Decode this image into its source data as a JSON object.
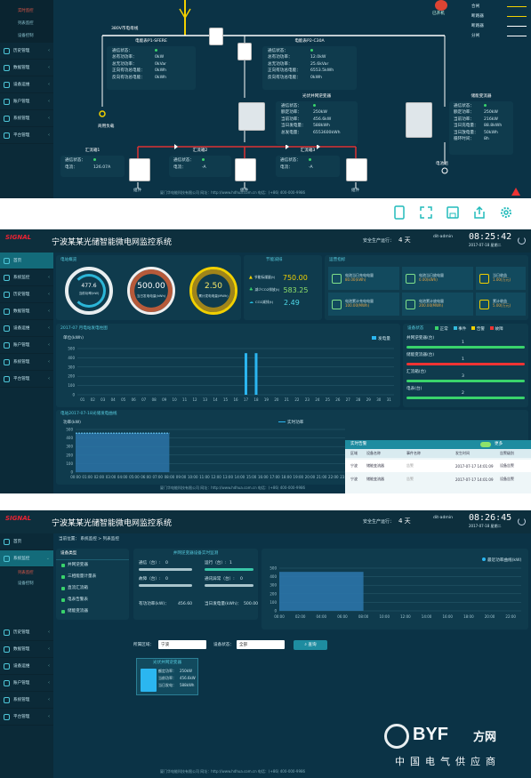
{
  "sec1": {
    "sidebar": {
      "sub": [
        "实时监控",
        "列表监控",
        "设备控制"
      ],
      "items": [
        "历史管理",
        "数据管理",
        "设备运维",
        "账户管理",
        "系统管理",
        "平台管理"
      ]
    },
    "legend": [
      "合闸",
      "断路器",
      "断路器",
      "分闸"
    ],
    "alarm_label": "已开机",
    "bus_label": "380V市电母线",
    "load_label": "商用负载",
    "grid_label": "电池组",
    "meter1": {
      "title": "电能表P1-SFERE",
      "rows": [
        [
          "通信状态：",
          ""
        ],
        [
          "总有功功率：",
          "0kW"
        ],
        [
          "总无功功率：",
          "0kVar"
        ],
        [
          "正向有功总电能：",
          "0kWh"
        ],
        [
          "反向有功总电能：",
          "0kWh"
        ]
      ]
    },
    "meter2": {
      "title": "电能表P2-C30A",
      "rows": [
        [
          "通信状态：",
          ""
        ],
        [
          "总有功功率：",
          "12.0kW"
        ],
        [
          "总无功功率：",
          "25.6kVar"
        ],
        [
          "正向有功总电能：",
          "6553.5kWh"
        ],
        [
          "反向有功总电能：",
          "0kWh"
        ]
      ]
    },
    "pv": {
      "title": "光伏并网逆变器",
      "rows": [
        [
          "通信状态：",
          ""
        ],
        [
          "额定功率：",
          "250kW"
        ],
        [
          "当前功率：",
          "456.6kW"
        ],
        [
          "当日发电量：",
          "588kWh"
        ],
        [
          "总发电量：",
          "6553600kWh"
        ]
      ]
    },
    "storage": {
      "title": "储能变流器",
      "rows": [
        [
          "通信状态：",
          ""
        ],
        [
          "额定功率：",
          "250kW"
        ],
        [
          "当前功率：",
          "216kW"
        ],
        [
          "当日充电量：",
          "88.8kWh"
        ],
        [
          "当日放电量：",
          "50kWh"
        ],
        [
          "循环时间：",
          "8h"
        ]
      ]
    },
    "boxes": [
      {
        "title": "汇流箱1",
        "rows": [
          [
            "通信状态：",
            ""
          ],
          [
            "电流：",
            "126.07A"
          ]
        ],
        "dev": "组件"
      },
      {
        "title": "汇流箱2",
        "rows": [
          [
            "通信状态：",
            ""
          ],
          [
            "电流：",
            "-A"
          ]
        ],
        "dev": "组件"
      },
      {
        "title": "汇流箱3",
        "rows": [
          [
            "通信状态：",
            ""
          ],
          [
            "电流：",
            "-A"
          ]
        ],
        "dev": "组件"
      }
    ],
    "footer": "厦门华电能科技有限公司      网址：http://www.hdhua.com.cn      电话：(+86) 400-000-9986"
  },
  "sec2": {
    "logo": "SIGNAL",
    "title": "宁波某某光储智能微电网监控系统",
    "safe_days_label": "安全生产运行：",
    "safe_days": "4 天",
    "user": "dit-admin",
    "time": "08:25:42",
    "date": "2017-07-18 星期二",
    "sidebar": [
      "首页",
      "系统监控",
      "历史管理",
      "数据管理",
      "设备运维",
      "账户管理",
      "系统管理",
      "平台管理"
    ],
    "gauge_title": "电站概览",
    "gauges": [
      {
        "value": "477.6",
        "label": "当前功率(kW)"
      },
      {
        "value": "500.00",
        "label": "当日发电电量(kWh)"
      },
      {
        "value": "2.50",
        "label": "累计发电电量(MWh)"
      }
    ],
    "eco_title": "节能减排",
    "eco": [
      {
        "label": "节能标煤量(t)",
        "value": "750.00"
      },
      {
        "label": "减少CO2排放(t)",
        "value": "583.25"
      },
      {
        "label": "CO2减排(t)",
        "value": "2.49"
      }
    ],
    "energy_title": "运营指标",
    "energy": [
      {
        "label": "电池当日充电电量",
        "value": "80.00(kWh)"
      },
      {
        "label": "电池当日放电量",
        "value": "0.00(kWh)"
      },
      {
        "label": "当日收益",
        "value": "1.00(万元)"
      },
      {
        "label": "电池累计充电电量",
        "value": "100.00(MWh)"
      },
      {
        "label": "电池累计放电量",
        "value": "200.00(MWh)"
      },
      {
        "label": "累计收益",
        "value": "5.00(万元)"
      }
    ],
    "chart1_title": "2017-07 月电站发电柱图",
    "chart1_unit": "单位(kWh)",
    "chart1_legend": "发电量",
    "chart2_title": "电站2017-07-18光储发电曲线",
    "chart2_unit": "功率(kW)",
    "chart2_legend": "实时功率",
    "status_title": "设备状态",
    "status_legend": [
      "正常",
      "事件",
      "告警",
      "故障"
    ],
    "status_rows": [
      {
        "name": "并网逆变器(台)",
        "count": "1"
      },
      {
        "name": "储能变流器(台)",
        "count": "1"
      },
      {
        "name": "汇流箱(台)",
        "count": "3"
      },
      {
        "name": "电表(台)",
        "count": "2"
      }
    ],
    "alarm": {
      "title": "实时告警",
      "more": "更多",
      "cols": [
        "区域",
        "设备名称",
        "事件名称",
        "发生时间",
        "告警级别"
      ],
      "rows": [
        [
          "宁波",
          "储能变流器",
          "告警",
          "2017-07-17 14:01:09",
          "设备告警"
        ],
        [
          "宁波",
          "储能变流器",
          "告警",
          "2017-07-17 14:01:09",
          "设备告警"
        ]
      ]
    },
    "footer": "厦门华电能科技有限公司      网址：http://www.hdhua.com.cn      电话：(+86) 400-000-9986"
  },
  "sec3": {
    "title": "宁波某某光储智能微电网监控系统",
    "safe_days_label": "安全生产运行：",
    "safe_days": "4 天",
    "user": "dit-admin",
    "time": "08:26:45",
    "date": "2017-07-18 星期二",
    "breadcrumb": "当前位置：  系统监控 > 列表监控",
    "sidebar_top": [
      "首页",
      "系统监控"
    ],
    "sidebar_sub": [
      "列表监控",
      "设备控制"
    ],
    "sidebar_rest": [
      "历史管理",
      "数据管理",
      "设备运维",
      "账户管理",
      "系统管理",
      "平台管理"
    ],
    "device_type_title": "设备类型",
    "device_types": [
      "并网逆变器",
      "三相能量计量表",
      "直流汇流箱",
      "电表告警表",
      "储能变流器"
    ],
    "summary_title": "并网逆变器设备实时监测",
    "summary": [
      [
        "通信（台）:",
        "0"
      ],
      [
        "运行（台）:",
        "1"
      ],
      [
        "故障（台）:",
        "0"
      ],
      [
        "通讯异常（台）:",
        "0"
      ],
      [
        "有功功率(kW)：",
        "456.60"
      ],
      [
        "当日发电量(kWh)：",
        "500.00"
      ]
    ],
    "chart_legend": "最近功率曲线(kW)",
    "filter_label1": "所属区域：",
    "filter_value1": "宁波",
    "filter_label2": "设备状态：",
    "filter_value2": "全部",
    "search_btn": "查询",
    "card": {
      "title": "光伏并网逆变器",
      "rows": [
        [
          "额定功率：",
          "250kW"
        ],
        [
          "当前功率：",
          "456.6kW"
        ],
        [
          "当日发电：",
          "588kWh"
        ]
      ]
    },
    "footer": "厦门华电能科技有限公司      网址：http://www.hdhua.com.cn      电话：(+86) 400-000-9986",
    "watermark_brand": "BYF",
    "watermark_cn": "方网",
    "watermark_sub": "中国电气供应商"
  }
}
